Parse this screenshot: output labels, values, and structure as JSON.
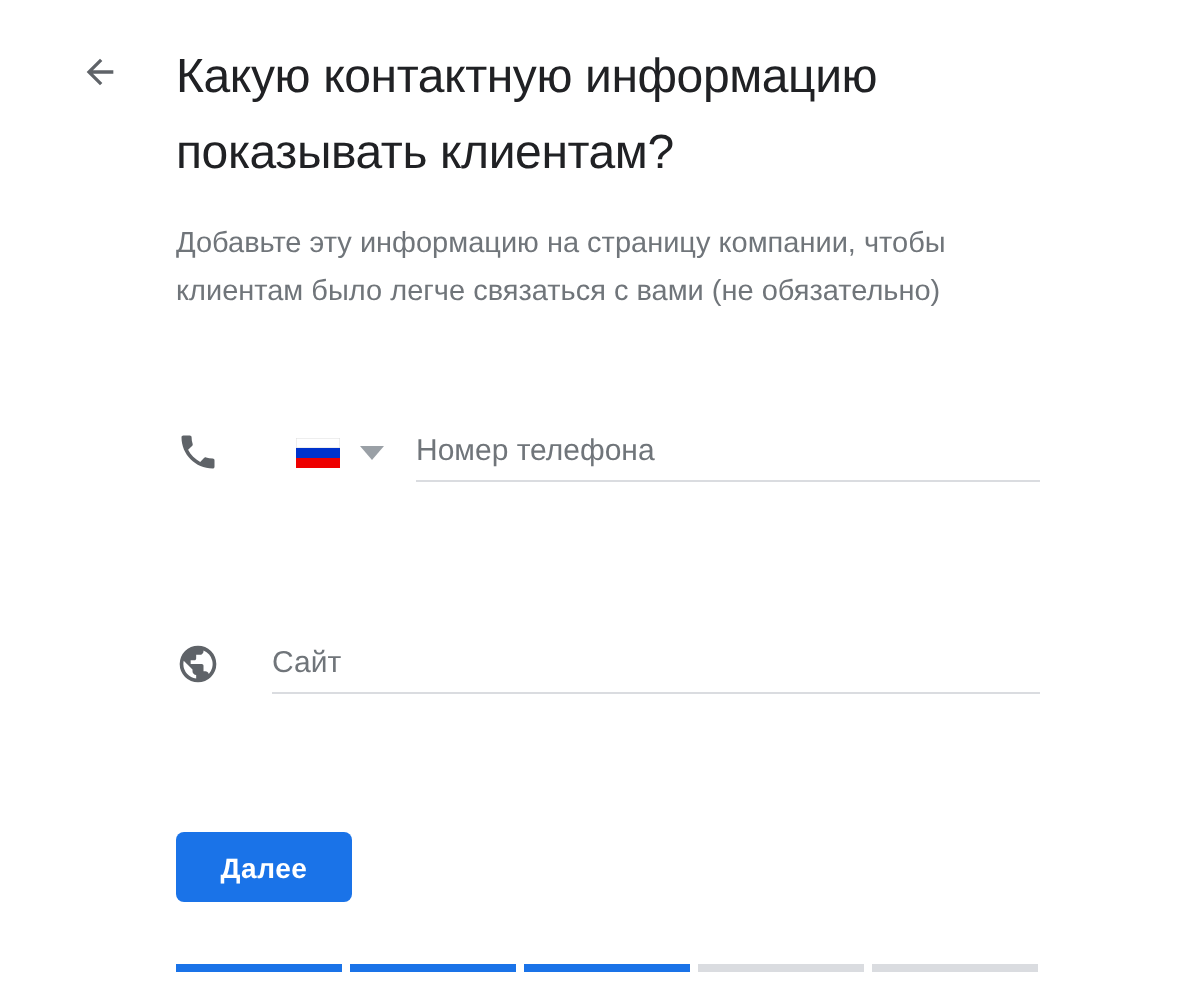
{
  "title": "Какую контактную информацию показывать клиентам?",
  "subtitle": "Добавьте эту информацию на страницу компании, чтобы клиентам было легче связаться с вами (не обязательно)",
  "fields": [
    {
      "kind": "phone",
      "placeholder": "Номер телефона"
    },
    {
      "kind": "website",
      "placeholder": "Сайт"
    }
  ],
  "next_button": "Далее",
  "progress": [
    {
      "complete": true
    },
    {
      "complete": true
    },
    {
      "complete": true
    },
    {
      "complete": false
    },
    {
      "complete": false
    }
  ]
}
